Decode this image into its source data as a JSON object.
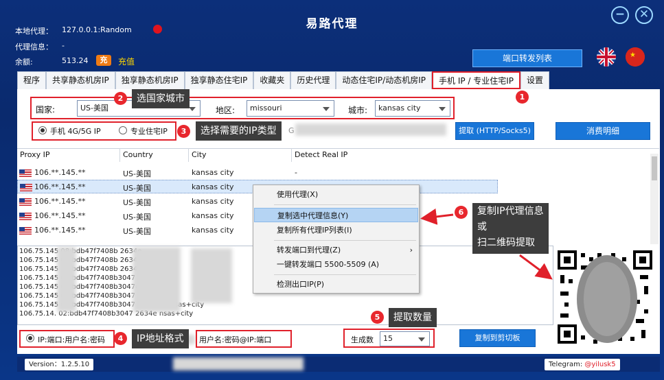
{
  "window": {
    "title": "易路代理",
    "minimize_icon": "minus-circle-icon",
    "close_icon": "close-circle-icon"
  },
  "header": {
    "local_proxy_label": "本地代理：",
    "local_proxy_value": "127.0.0.1:Random",
    "proxy_info_label": "代理信息：",
    "proxy_info_value": "-",
    "balance_label": "余额:",
    "balance_value": "513.24",
    "recharge_icon_text": "充",
    "recharge_label": "充值",
    "port_forward_button": "端口转发列表",
    "status_dot_color": "#e0141e"
  },
  "tabs": [
    "程序",
    "共享静态机房IP",
    "独享静态机房IP",
    "独享静态住宅IP",
    "收藏夹",
    "历史代理",
    "动态住宅IP/动态机房IP",
    "手机 IP / 专业住宅IP",
    "设置"
  ],
  "active_tab": "手机 IP / 专业住宅IP",
  "filters": {
    "country_label": "国家:",
    "country_value": "US-美国",
    "region_label": "地区:",
    "region_value": "missouri",
    "city_label": "城市:",
    "city_value": "kansas city"
  },
  "ip_type": {
    "option1": "手机 4G/5G IP",
    "option2": "专业住宅IP",
    "partial_text": "G"
  },
  "buttons": {
    "extract": "提取 (HTTP/Socks5)",
    "consume_detail": "消费明细",
    "copy_clipboard": "复制到剪切板"
  },
  "table": {
    "headers": [
      "Proxy IP",
      "Country",
      "City",
      "Detect Real IP"
    ],
    "rows": [
      {
        "ip": "106.**.145.**",
        "country": "US-美国",
        "city": "kansas city",
        "real": "-"
      },
      {
        "ip": "106.**.145.**",
        "country": "US-美国",
        "city": "kansas city",
        "real": ""
      },
      {
        "ip": "106.**.145.**",
        "country": "US-美国",
        "city": "kansas city",
        "real": ""
      },
      {
        "ip": "106.**.145.**",
        "country": "US-美国",
        "city": "kansas city",
        "real": ""
      },
      {
        "ip": "106.**.145.**",
        "country": "US-美国",
        "city": "kansas city",
        "real": ""
      }
    ]
  },
  "output_lines": [
    "106.75.145  08:bdb47f7408b  2634e",
    "106.75.145  08:bdb47f7408b  2634e",
    "106.75.145  10:bdb47f7408b  2634e",
    "106.75.145  07:bdb47f7408b3047  2634e",
    "106.75.145  05:bdb47f7408b3047e  221634e",
    "106.75.145  05:bdb47f7408b3047  2634e",
    "106.75.145  07:bdb47f7408b3047  221634e  nsas+city",
    "106.75.14.  02:bdb47f7408b3047  2634e  nsas+city"
  ],
  "context_menu": [
    "使用代理(X)",
    "复制选中代理信息(Y)",
    "复制所有代理IP列表(I)",
    "转发端口到代理(Z)",
    "一键转发端口 5500-5509 (A)",
    "检测出口IP(P)"
  ],
  "formats": {
    "format1": "IP:端口:用户名:密码",
    "format2": "用户名:密码@IP:端口"
  },
  "generate": {
    "label": "生成数",
    "value": "15"
  },
  "annotations": {
    "a1": "1",
    "a2_num": "2",
    "a2": "选国家城市",
    "a3_num": "3",
    "a3": "选择需要的IP类型",
    "a4_num": "4",
    "a4": "IP地址格式",
    "a5_num": "5",
    "a5": "提取数量",
    "a6_num": "6",
    "a6_line1": "复制IP代理信息",
    "a6_line2": "或",
    "a6_line3": "扫二维码提取"
  },
  "status_bar": {
    "version": "Version：1.2.5.10",
    "telegram_label": "Telegram:",
    "telegram_handle": "@yilusk5"
  }
}
